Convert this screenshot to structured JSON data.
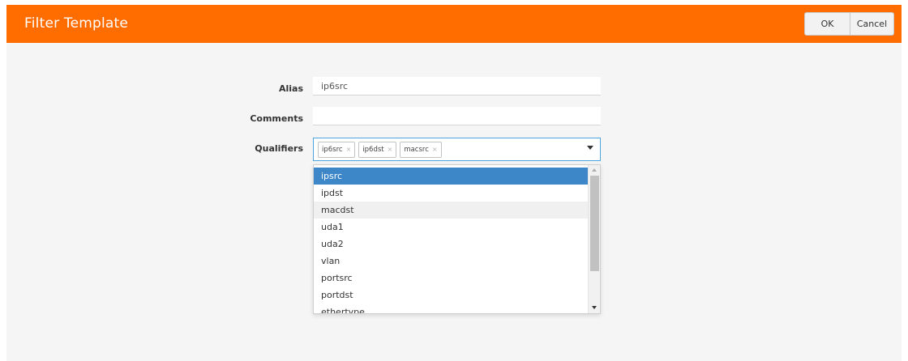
{
  "title": "Filter Template",
  "buttons": {
    "ok": "OK",
    "cancel": "Cancel"
  },
  "form": {
    "alias": {
      "label": "Alias",
      "value": "ip6src"
    },
    "comments": {
      "label": "Comments",
      "value": ""
    },
    "qualifiers": {
      "label": "Qualifiers",
      "tags": [
        "ip6src",
        "ip6dst",
        "macsrc"
      ],
      "remove_glyph": "×"
    }
  },
  "dropdown": {
    "options": [
      "ipsrc",
      "ipdst",
      "macdst",
      "uda1",
      "uda2",
      "vlan",
      "portsrc",
      "portdst",
      "ethertype"
    ],
    "selected": "ipsrc",
    "hovered": "macdst"
  },
  "colors": {
    "titlebar": "#ff6c00",
    "selected_option": "#3d87c9",
    "focus_border": "#4ea4dc",
    "background": "#f5f5f5"
  }
}
